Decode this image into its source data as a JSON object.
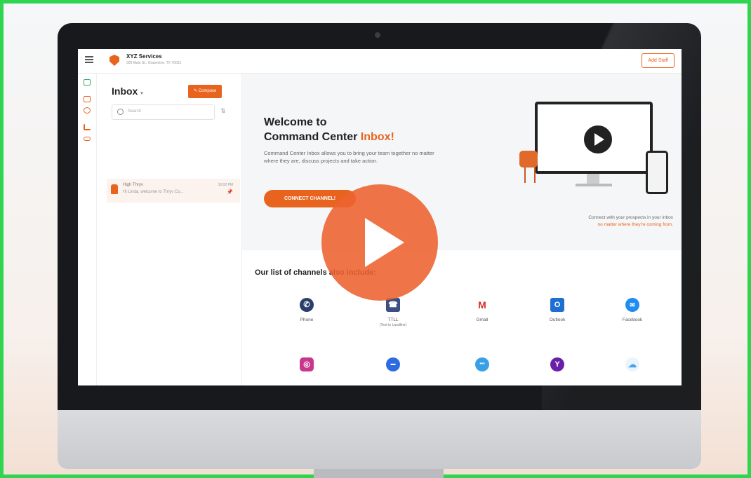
{
  "app": {
    "company_name": "XYZ Services",
    "company_address": "300 Main St., Grapevine, TX 76051",
    "add_staff_label": "Add Staff"
  },
  "inbox": {
    "title": "Inbox",
    "dropdown_icon": "chevron-down-icon",
    "compose_label": "Compose",
    "search_placeholder": "Search",
    "message": {
      "sender": "High Thryv",
      "time": "10:02 PM",
      "preview": "Hi Linda, welcome to Thryv Co..."
    }
  },
  "welcome": {
    "line1": "Welcome to",
    "line2_prefix": "Command Center ",
    "line2_highlight": "Inbox!",
    "description": "Command Center Inbox allows you to bring your team together no matter where they are, discuss projects and take action.",
    "connect_label": "CONNECT CHANNEL!",
    "caption_line1": "Connect with your prospects in your inbox",
    "caption_line2": "no matter where they're coming from."
  },
  "channels": {
    "title": "Our list of channels also include:",
    "items": [
      {
        "label": "Phone",
        "icon": "phone-icon",
        "color": "#2b3e6b",
        "glyph": "✆"
      },
      {
        "label": "TTLL",
        "sub": "(Text to Landline)",
        "icon": "landline-icon",
        "color": "#3b4f84",
        "glyph": "☎"
      },
      {
        "label": "Gmail",
        "icon": "gmail-icon",
        "color": "#ffffff",
        "glyph": "M"
      },
      {
        "label": "Outlook",
        "icon": "outlook-icon",
        "color": "#1f6fd1",
        "glyph": "O"
      },
      {
        "label": "Facebook",
        "icon": "messenger-icon",
        "color": "#1f8cf0",
        "glyph": "✉"
      }
    ],
    "row2": [
      {
        "icon": "instagram-icon",
        "color": "#c9368d",
        "glyph": "◎"
      },
      {
        "icon": "chat-bubble-icon",
        "color": "#2c6be0",
        "glyph": "▬"
      },
      {
        "icon": "webchat-icon",
        "color": "#3aa0e6",
        "glyph": "•••"
      },
      {
        "icon": "yahoo-icon",
        "color": "#6a1fa8",
        "glyph": "Y"
      },
      {
        "icon": "cloud-icon",
        "color": "#7bc0ef",
        "glyph": "☁"
      }
    ]
  },
  "video": {
    "play_icon": "play-icon",
    "accent": "#ed6230"
  }
}
